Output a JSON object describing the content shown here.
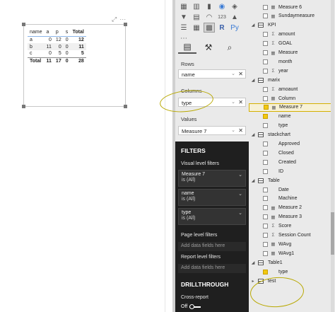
{
  "matrix": {
    "headers": [
      "name",
      "a",
      "p",
      "s",
      "Total"
    ],
    "rows": [
      {
        "name": "a",
        "a": "0",
        "p": "12",
        "s": "0",
        "total": "12"
      },
      {
        "name": "b",
        "a": "11",
        "p": "0",
        "s": "0",
        "total": "11"
      },
      {
        "name": "c",
        "a": "0",
        "p": "5",
        "s": "0",
        "total": "5"
      }
    ],
    "total_row": {
      "name": "Total",
      "a": "11",
      "p": "17",
      "s": "0",
      "total": "28"
    }
  },
  "viz_pane": {
    "rows_label": "Rows",
    "rows_value": "name",
    "columns_label": "Columns",
    "columns_value": "type",
    "values_label": "Values",
    "values_value": "Measure 7",
    "filters_title": "FILTERS",
    "visual_filters_label": "Visual level filters",
    "filter_cards": [
      {
        "field": "Measure 7",
        "state": "is (All)"
      },
      {
        "field": "name",
        "state": "is (All)"
      },
      {
        "field": "type",
        "state": "is (All)"
      }
    ],
    "page_filters_label": "Page level filters",
    "add_fields_1": "Add data fields here",
    "report_filters_label": "Report level filters",
    "add_fields_2": "Add data fields here",
    "drillthrough_title": "DRILLTHROUGH",
    "cross_report_label": "Cross-report",
    "toggle_label": "Off"
  },
  "fields_pane": {
    "items": [
      {
        "kind": "field",
        "icon": "measure",
        "label": "Measure 6",
        "checked": false
      },
      {
        "kind": "field",
        "icon": "measure",
        "label": "Sundaymeasure",
        "checked": false
      },
      {
        "kind": "table",
        "label": "KPI"
      },
      {
        "kind": "field",
        "icon": "sigma",
        "label": "amount",
        "checked": false
      },
      {
        "kind": "field",
        "icon": "sigma",
        "label": "GOAL",
        "checked": false
      },
      {
        "kind": "field",
        "icon": "measure",
        "label": "Measure",
        "checked": false
      },
      {
        "kind": "field",
        "icon": "none",
        "label": "month",
        "checked": false
      },
      {
        "kind": "field",
        "icon": "sigma",
        "label": "year",
        "checked": false
      },
      {
        "kind": "table",
        "label": "marix"
      },
      {
        "kind": "field",
        "icon": "sigma",
        "label": "amoaunt",
        "checked": false
      },
      {
        "kind": "field",
        "icon": "measure",
        "label": "Column",
        "checked": false
      },
      {
        "kind": "field",
        "icon": "measure",
        "label": "Measure 7",
        "checked": true
      },
      {
        "kind": "field",
        "icon": "none",
        "label": "name",
        "checked": true
      },
      {
        "kind": "field",
        "icon": "none",
        "label": "type",
        "checked": false
      },
      {
        "kind": "table",
        "label": "stackchart"
      },
      {
        "kind": "field",
        "icon": "none",
        "label": "Approved",
        "checked": false
      },
      {
        "kind": "field",
        "icon": "none",
        "label": "Closed",
        "checked": false
      },
      {
        "kind": "field",
        "icon": "none",
        "label": "Created",
        "checked": false
      },
      {
        "kind": "field",
        "icon": "none",
        "label": "ID",
        "checked": false
      },
      {
        "kind": "table",
        "label": "Table"
      },
      {
        "kind": "field",
        "icon": "none",
        "label": "Date",
        "checked": false
      },
      {
        "kind": "field",
        "icon": "none",
        "label": "Machine",
        "checked": false
      },
      {
        "kind": "field",
        "icon": "measure",
        "label": "Measure 2",
        "checked": false
      },
      {
        "kind": "field",
        "icon": "measure",
        "label": "Measure 3",
        "checked": false
      },
      {
        "kind": "field",
        "icon": "sigma",
        "label": "Score",
        "checked": false
      },
      {
        "kind": "field",
        "icon": "sigma",
        "label": "Session Count",
        "checked": false
      },
      {
        "kind": "field",
        "icon": "measure",
        "label": "WAvg",
        "checked": false
      },
      {
        "kind": "field",
        "icon": "measure",
        "label": "WAvg1",
        "checked": false
      },
      {
        "kind": "table",
        "label": "Table1"
      },
      {
        "kind": "field",
        "icon": "none",
        "label": "type",
        "checked": true
      },
      {
        "kind": "table",
        "label": "test"
      }
    ]
  },
  "colors": {
    "accent": "#f2c811",
    "dark_panel": "#1f1f1f",
    "pane_bg": "#eaeaea",
    "annotation": "#b8a800"
  }
}
